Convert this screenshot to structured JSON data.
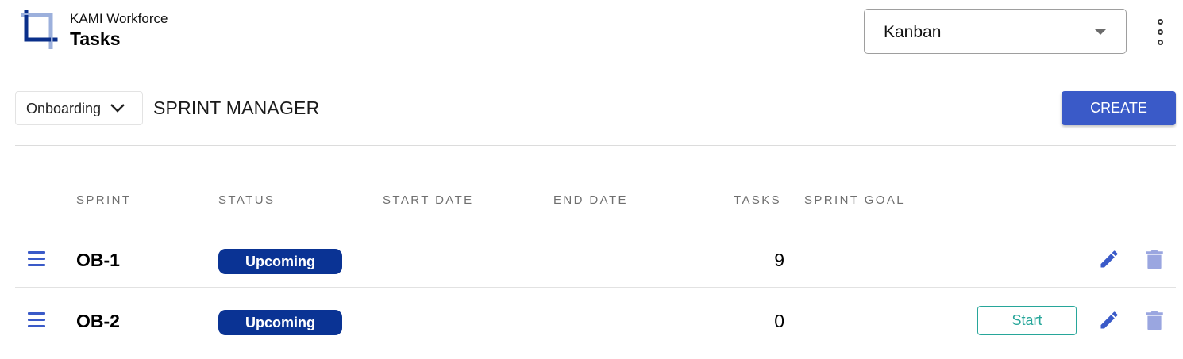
{
  "header": {
    "app_name": "KAMI Workforce",
    "page_name": "Tasks",
    "logo_icon": "crop-icon",
    "view_select": {
      "value": "Kanban"
    },
    "more_icon": "more-vertical-icon"
  },
  "toolbar": {
    "project_select": {
      "value": "Onboarding"
    },
    "section_title": "SPRINT MANAGER",
    "create_label": "CREATE"
  },
  "table": {
    "columns": [
      "SPRINT",
      "STATUS",
      "START DATE",
      "END DATE",
      "TASKS",
      "SPRINT GOAL"
    ],
    "rows": [
      {
        "sprint": "OB-1",
        "status": "Upcoming",
        "start_date": "",
        "end_date": "",
        "tasks": "9",
        "goal": "",
        "action": ""
      },
      {
        "sprint": "OB-2",
        "status": "Upcoming",
        "start_date": "",
        "end_date": "",
        "tasks": "0",
        "goal": "",
        "action": "Start"
      }
    ]
  },
  "colors": {
    "accent": "#3a5ac8",
    "status_badge": "#0a3394",
    "start_button": "#27a69a",
    "delete_icon": "#9aa6e0"
  }
}
